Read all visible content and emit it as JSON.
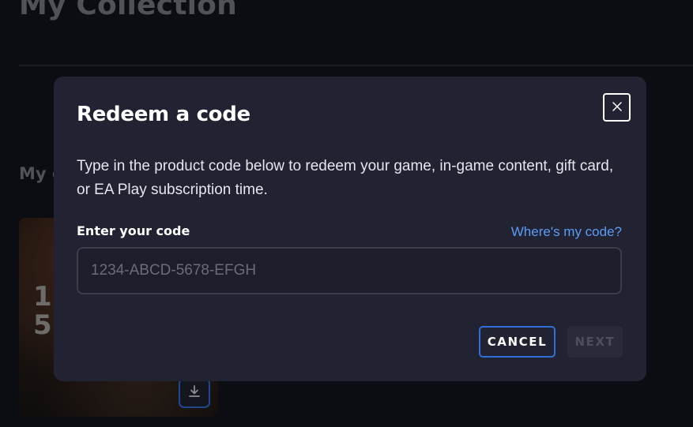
{
  "background": {
    "title": "My Collection",
    "section_title": "My g",
    "card_art_text": "1\n5",
    "download_icon": "download-icon"
  },
  "modal": {
    "title": "Redeem a code",
    "description": "Type in the product code below to redeem your game, in-game content, gift card, or EA Play subscription time.",
    "code_label": "Enter your code",
    "help_link": "Where's my code?",
    "input_placeholder": "1234-ABCD-5678-EFGH",
    "input_value": "",
    "close_icon": "close-icon",
    "cancel_label": "CANCEL",
    "next_label": "NEXT"
  },
  "colors": {
    "accent": "#2f6fd6",
    "link": "#5b9cf5",
    "modal_bg": "#212232",
    "page_bg": "#13141c"
  }
}
